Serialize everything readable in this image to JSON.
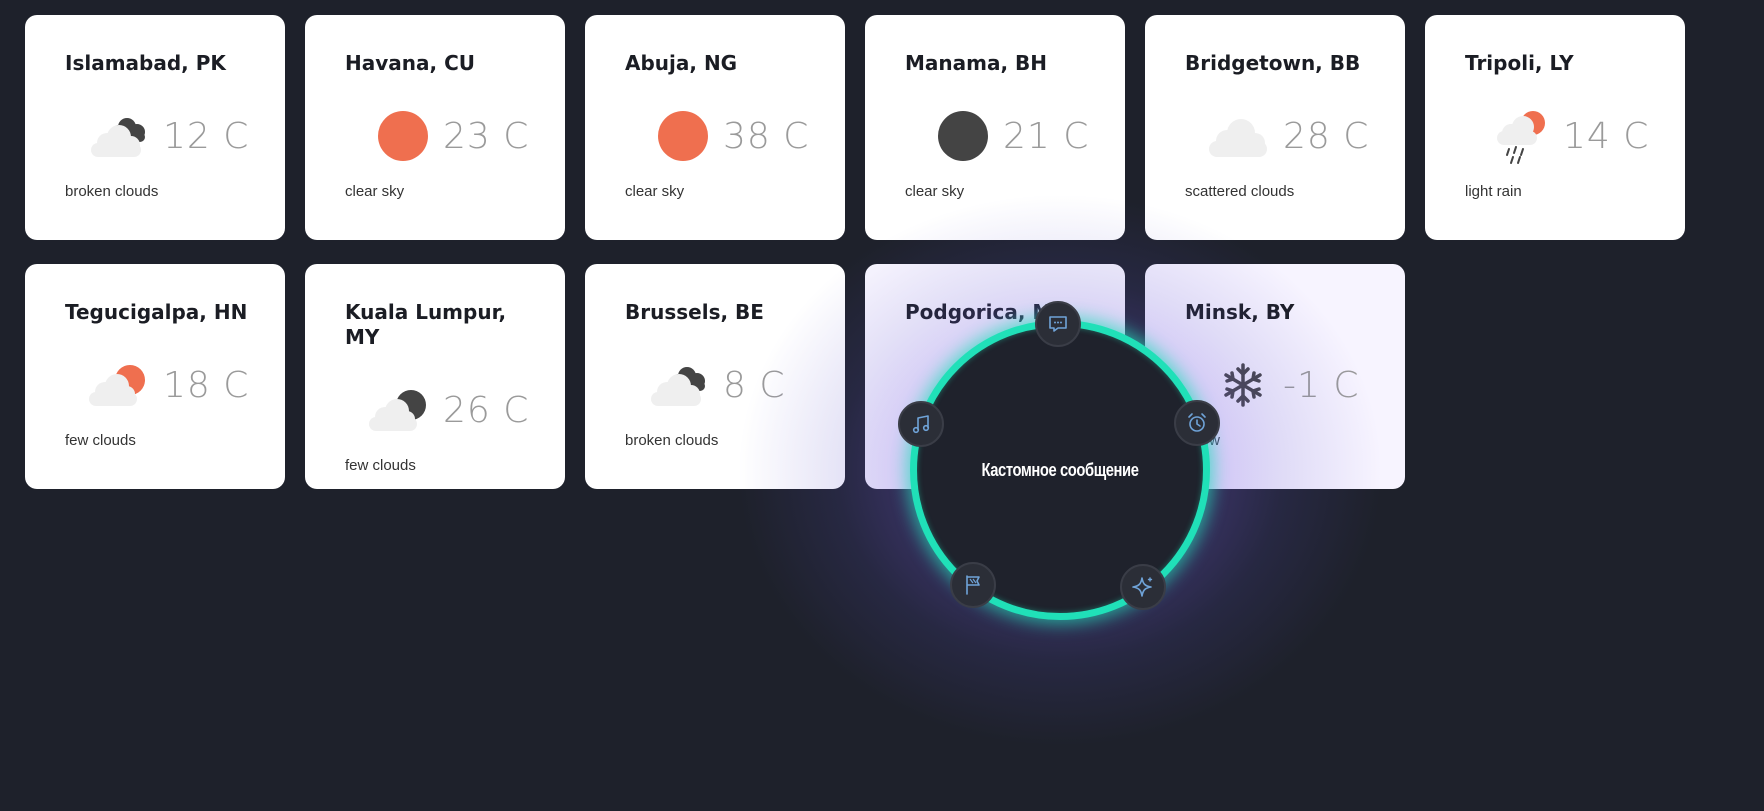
{
  "cards": [
    {
      "city": "Islamabad, PK",
      "temp": "12 C",
      "desc": "broken clouds",
      "icon": "broken-clouds-icon"
    },
    {
      "city": "Havana, CU",
      "temp": "23 C",
      "desc": "clear sky",
      "icon": "sun-icon"
    },
    {
      "city": "Abuja, NG",
      "temp": "38 C",
      "desc": "clear sky",
      "icon": "sun-icon"
    },
    {
      "city": "Manama, BH",
      "temp": "21 C",
      "desc": "clear sky",
      "icon": "moon-icon"
    },
    {
      "city": "Bridgetown, BB",
      "temp": "28 C",
      "desc": "scattered clouds",
      "icon": "cloud-icon"
    },
    {
      "city": "Tripoli, LY",
      "temp": "14 C",
      "desc": "light rain",
      "icon": "rain-sun-icon"
    },
    {
      "city": "Tegucigalpa, HN",
      "temp": "18 C",
      "desc": "few clouds",
      "icon": "few-clouds-day-icon"
    },
    {
      "city": "Kuala Lumpur, MY",
      "temp": "26 C",
      "desc": "few clouds",
      "icon": "few-clouds-night-icon"
    },
    {
      "city": "Brussels, BE",
      "temp": "8 C",
      "desc": "broken clouds",
      "icon": "broken-clouds-icon"
    },
    {
      "city": "Podgorica, M",
      "temp": "",
      "desc": "",
      "icon": ""
    },
    {
      "city": "Minsk, BY",
      "temp": "-1 C",
      "desc": "snow",
      "icon": "snowflake-icon"
    }
  ],
  "radial_menu": {
    "label": "Кастомное сообщение",
    "buttons": [
      {
        "icon": "message-icon"
      },
      {
        "icon": "alarm-clock-icon"
      },
      {
        "icon": "sparkle-icon"
      },
      {
        "icon": "flag-icon"
      },
      {
        "icon": "music-note-icon"
      }
    ]
  },
  "colors": {
    "background": "#1e212b",
    "card": "#ffffff",
    "sun": "#ef6f4f",
    "moon": "#444444",
    "cloud": "#efefef",
    "ring": "#20e0b8",
    "menu_icon": "#6fa3d8"
  }
}
